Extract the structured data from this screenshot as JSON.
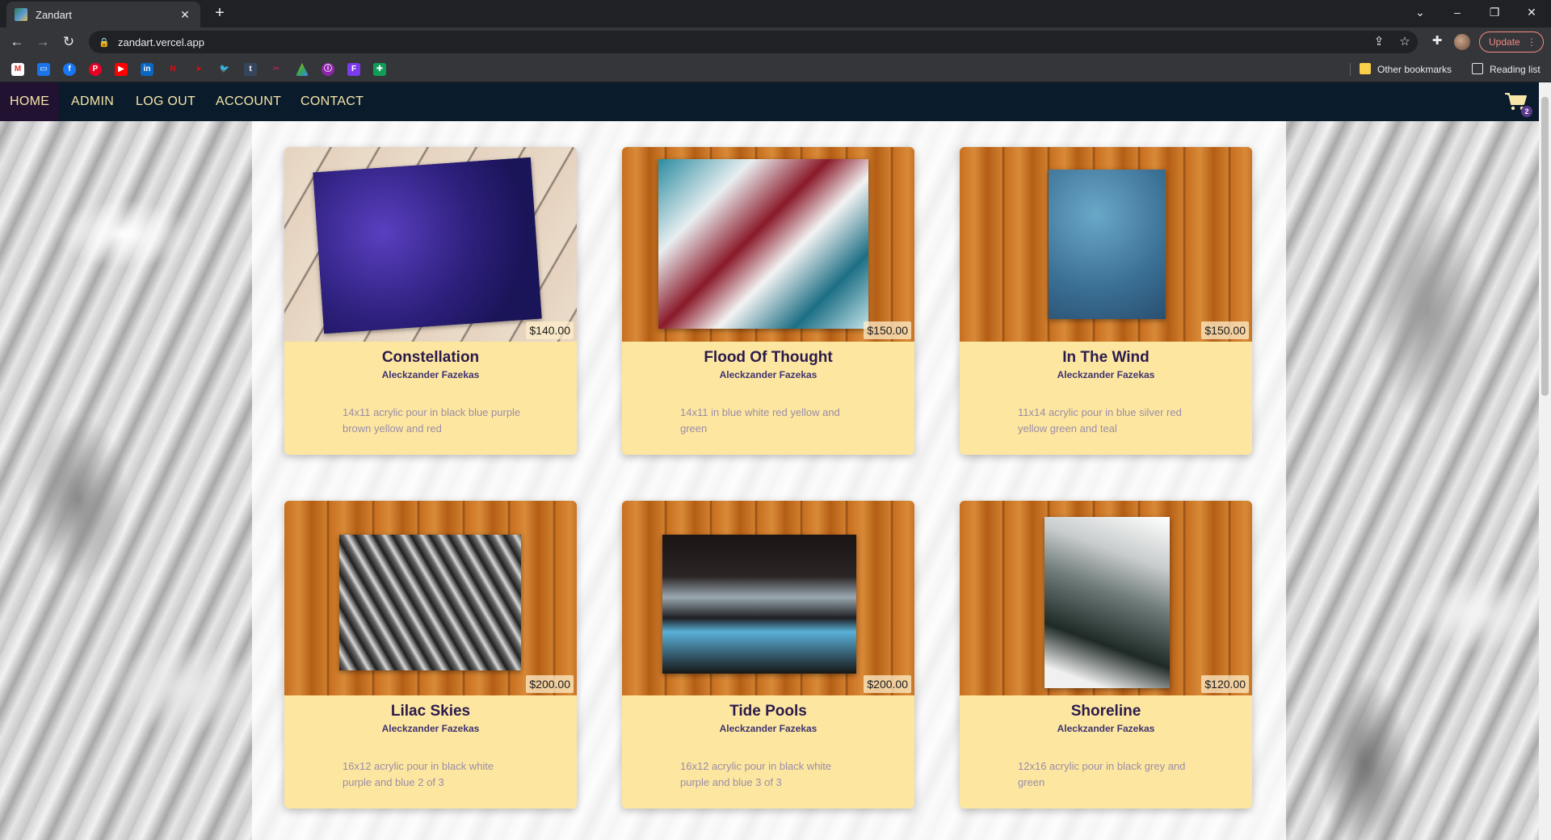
{
  "browser": {
    "tab_title": "Zandart",
    "tab_close": "✕",
    "new_tab": "+",
    "url": "zandart.vercel.app",
    "update_label": "Update",
    "bookmarks_right": [
      "Other bookmarks",
      "Reading list"
    ]
  },
  "nav": {
    "items": [
      "HOME",
      "ADMIN",
      "LOG OUT",
      "ACCOUNT",
      "CONTACT"
    ],
    "active": "HOME",
    "cart_count": "2"
  },
  "products": [
    {
      "title": "Constellation",
      "artist": "Aleckzander Fazekas",
      "price": "$140.00",
      "description": "14x11 acrylic pour in black blue purple brown yellow and red"
    },
    {
      "title": "Flood Of Thought",
      "artist": "Aleckzander Fazekas",
      "price": "$150.00",
      "description": "14x11 in blue white red yellow and green"
    },
    {
      "title": "In The Wind",
      "artist": "Aleckzander Fazekas",
      "price": "$150.00",
      "description": "11x14 acrylic pour in blue silver red yellow green and teal"
    },
    {
      "title": "Lilac Skies",
      "artist": "Aleckzander Fazekas",
      "price": "$200.00",
      "description": "16x12 acrylic pour in black white purple and blue 2 of 3"
    },
    {
      "title": "Tide Pools",
      "artist": "Aleckzander Fazekas",
      "price": "$200.00",
      "description": "16x12 acrylic pour in black white purple and blue 3 of 3"
    },
    {
      "title": "Shoreline",
      "artist": "Aleckzander Fazekas",
      "price": "$120.00",
      "description": "12x16 acrylic pour in black grey and green"
    }
  ],
  "colors": {
    "navbar_bg": "#0a1b2c",
    "nav_text": "#f6e6a8",
    "active_bg": "#211232",
    "card_bg": "#fde7a0",
    "title_color": "#2b1a4c",
    "desc_color": "#9a8ca8"
  }
}
